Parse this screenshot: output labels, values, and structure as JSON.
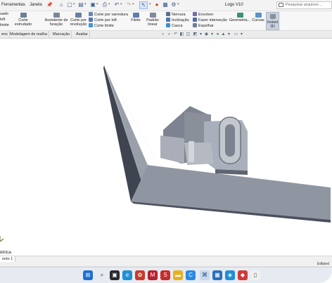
{
  "titlebar": {
    "menu_items": [
      "Ferramentas",
      "Janela"
    ],
    "document_title": "Logo V10",
    "search_placeholder": "Pesquisar arquivos ..."
  },
  "ribbon": {
    "left_cut_labels": [
      "sado",
      "loft",
      "limite"
    ],
    "corte_extrudado": "Corte extrudado",
    "assistente_furacao": "Assistente de furação",
    "corte_por_revolucao": "Corte por revolução",
    "corte_por_varredura": "Corte por varredura",
    "corte_por_loft": "Corte por loft",
    "corte_limite": "Corte limite",
    "filete": "Filete",
    "padrao_linear": "Padrão linear",
    "nervura": "Nervura",
    "inclinacao": "Inclinação",
    "casca": "Casca",
    "envolver": "Envolver",
    "fazer_intersecao": "Fazer interseção",
    "espelhar": "Espelhar",
    "geometria": "Geometria...",
    "curvas": "Curvas",
    "instant3d": "Instant 3D"
  },
  "tabs": [
    "ens",
    "Modelagem de malha",
    "Marcação",
    "Avaliar"
  ],
  "graphics": {
    "view_label": "étrica"
  },
  "sheet": {
    "tab_label": "ento 1"
  },
  "status": {
    "right_text": "Editand"
  },
  "colors": {
    "ribbon_bg": "#f7f7f7",
    "model_face": "#8a909c",
    "taskbar_bg": "#e6ebf1"
  }
}
